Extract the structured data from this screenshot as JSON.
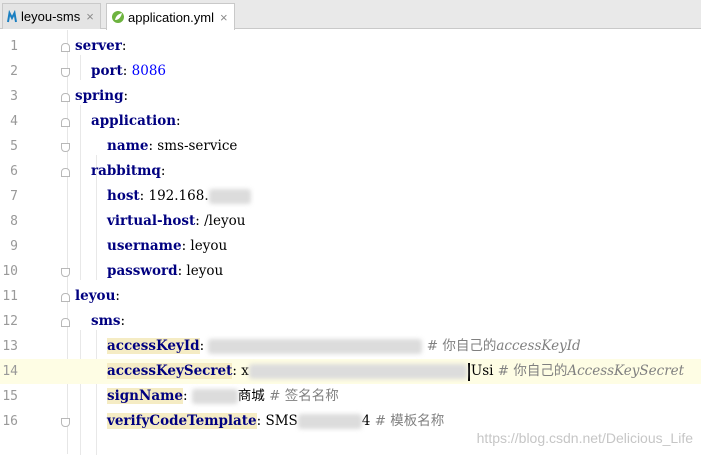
{
  "tabs": [
    {
      "label": "leyou-sms",
      "close": "×",
      "icon": "module-m-icon"
    },
    {
      "label": "application.yml",
      "close": "×",
      "icon": "yml-leaf-icon",
      "active": true
    }
  ],
  "lines": {
    "n1": "1",
    "n2": "2",
    "n3": "3",
    "n4": "4",
    "n5": "5",
    "n6": "6",
    "n7": "7",
    "n8": "8",
    "n9": "9",
    "n10": "10",
    "n11": "11",
    "n12": "12",
    "n13": "13",
    "n14": "14",
    "n15": "15",
    "n16": "16"
  },
  "code": {
    "server": "server",
    "port": "port",
    "port_value": "8086",
    "spring": "spring",
    "application": "application",
    "name": "name",
    "name_value": "sms-service",
    "rabbitmq": "rabbitmq",
    "host": "host",
    "host_value": "192.168.",
    "virtual_host": "virtual-host",
    "virtual_host_value": "/leyou",
    "username": "username",
    "username_value": "leyou",
    "password": "password",
    "password_value": "leyou",
    "leyou": "leyou",
    "sms": "sms",
    "access_key_id": "accessKeyId",
    "access_key_id_comment_cn": "# 你自己的",
    "access_key_id_comment_en": "accessKeyId",
    "access_key_secret": "accessKeySecret",
    "access_key_secret_prefix": "x",
    "access_key_secret_suffix": "Usi",
    "access_key_secret_comment_cn": "# 你自己的",
    "access_key_secret_comment_en": "AccessKeySecret",
    "sign_name": "signName",
    "sign_name_value_tail": "商城",
    "sign_name_comment": "# 签名名称",
    "verify_code_template": "verifyCodeTemplate",
    "verify_code_template_prefix": "SMS",
    "verify_code_template_suffix": "4",
    "verify_code_template_comment": "# 模板名称"
  },
  "watermark": "https://blog.csdn.net/Delicious_Life",
  "colors": {
    "key": "#000080",
    "number": "#0000ff",
    "comment": "#808080",
    "current_line": "#fefde4",
    "key_highlight": "#f5ecc4"
  }
}
